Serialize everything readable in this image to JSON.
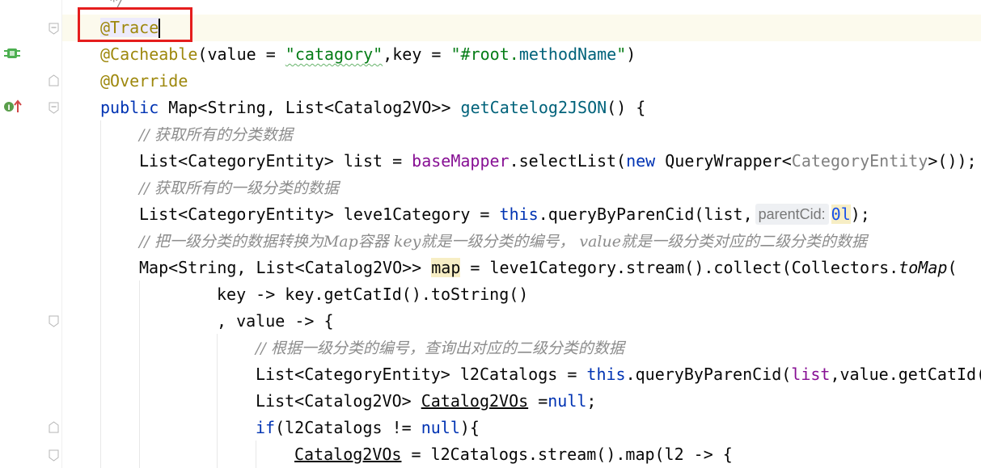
{
  "editor": {
    "lines": [
      {
        "id": "l0",
        "tokens": [
          {
            "t": "*/",
            "c": "cmt"
          }
        ]
      },
      {
        "id": "l1",
        "tokens": [
          {
            "t": "@Trace",
            "c": "ann hl-ann"
          }
        ]
      },
      {
        "id": "l2",
        "tokens": [
          {
            "t": "@Cacheable",
            "c": "ann"
          },
          {
            "t": "(value = "
          },
          {
            "t": "\"catagory\"",
            "c": "str strwave"
          },
          {
            "t": ",key = "
          },
          {
            "t": "\"#root.",
            "c": "str"
          },
          {
            "t": "methodName",
            "c": "mcall"
          },
          {
            "t": "\"",
            "c": "str"
          },
          {
            "t": ")"
          }
        ]
      },
      {
        "id": "l3",
        "tokens": [
          {
            "t": "@Override",
            "c": "ann"
          }
        ]
      },
      {
        "id": "l4",
        "tokens": [
          {
            "t": "public ",
            "c": "kw"
          },
          {
            "t": "Map<String, List<Catalog2VO>> "
          },
          {
            "t": "getCatelog2JSON",
            "c": "mcall"
          },
          {
            "t": "() {"
          }
        ]
      },
      {
        "id": "l5",
        "tokens": [
          {
            "t": "// 获取所有的分类数据",
            "c": "cmt"
          }
        ]
      },
      {
        "id": "l6",
        "tokens": [
          {
            "t": "List<CategoryEntity> list = "
          },
          {
            "t": "baseMapper",
            "c": "field"
          },
          {
            "t": ".selectList("
          },
          {
            "t": "new ",
            "c": "kw"
          },
          {
            "t": "QueryWrapper<"
          },
          {
            "t": "CategoryEntity",
            "c": "generic-gray"
          },
          {
            "t": ">());"
          }
        ]
      },
      {
        "id": "l7",
        "tokens": [
          {
            "t": "// 获取所有的一级分类的数据",
            "c": "cmt"
          }
        ]
      },
      {
        "id": "l8",
        "tokens": [
          {
            "t": "List<CategoryEntity> leve1Category = "
          },
          {
            "t": "this",
            "c": "kw"
          },
          {
            "t": ".queryByParenCid(list,"
          },
          {
            "t": "parentCid:",
            "c": "hint"
          },
          {
            "t": "0l",
            "c": "num hl-num"
          },
          {
            "t": ");"
          }
        ]
      },
      {
        "id": "l9",
        "tokens": [
          {
            "t": "// 把一级分类的数据转换为Map容器 key就是一级分类的编号， value就是一级分类对应的二级分类的数据",
            "c": "cmt"
          }
        ]
      },
      {
        "id": "l10",
        "tokens": [
          {
            "t": "Map<String, List<Catalog2VO>> "
          },
          {
            "t": "map",
            "c": "hl-map"
          },
          {
            "t": " = leve1Category.stream().collect(Collectors."
          },
          {
            "t": "toMap",
            "c": "ital"
          },
          {
            "t": "("
          }
        ]
      },
      {
        "id": "l11",
        "tokens": [
          {
            "t": "key -> key.getCatId().toString()"
          }
        ]
      },
      {
        "id": "l12",
        "tokens": [
          {
            "t": ", value -> {"
          }
        ]
      },
      {
        "id": "l13",
        "tokens": [
          {
            "t": "// 根据一级分类的编号，查询出对应的二级分类的数据",
            "c": "cmt"
          }
        ]
      },
      {
        "id": "l14",
        "tokens": [
          {
            "t": "List<CategoryEntity> l2Catalogs = "
          },
          {
            "t": "this",
            "c": "kw"
          },
          {
            "t": ".queryByParenCid("
          },
          {
            "t": "list",
            "c": "field"
          },
          {
            "t": ",value.getCatId("
          }
        ]
      },
      {
        "id": "l15",
        "tokens": [
          {
            "t": "List<Catalog2VO> "
          },
          {
            "t": "Catalog2VOs",
            "c": "ul"
          },
          {
            "t": " ="
          },
          {
            "t": "null",
            "c": "kw"
          },
          {
            "t": ";"
          }
        ]
      },
      {
        "id": "l16",
        "tokens": [
          {
            "t": "if",
            "c": "kw"
          },
          {
            "t": "(l2Catalogs != "
          },
          {
            "t": "null",
            "c": "kw"
          },
          {
            "t": "){"
          }
        ]
      },
      {
        "id": "l17",
        "tokens": [
          {
            "t": "Catalog2VOs",
            "c": "ul"
          },
          {
            "t": " = l2Catalogs.stream().map(l2 -> {"
          }
        ]
      }
    ]
  },
  "gutter": {
    "icons": [
      "implementation-icon",
      "overrides-method-icon"
    ]
  }
}
